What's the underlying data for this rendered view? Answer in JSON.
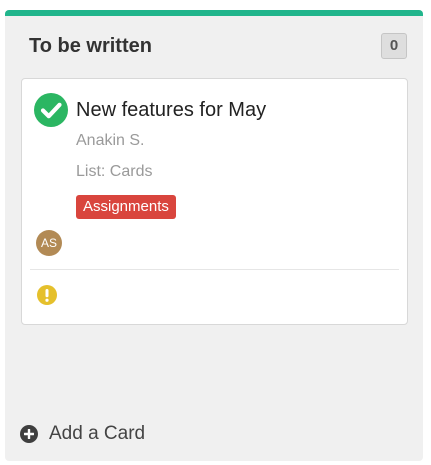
{
  "column": {
    "title": "To be written",
    "count": "0",
    "accent_color": "#21b58c"
  },
  "card": {
    "title": "New features for May",
    "owner": "Anakin S.",
    "list": "List: Cards",
    "tag": {
      "label": "Assignments",
      "color": "#d9453d"
    },
    "avatar_initials": "AS",
    "status_icon": "check-circle-icon",
    "status_color": "#2bb662",
    "alert_icon": "exclamation-circle-icon",
    "alert_color": "#e5c02c"
  },
  "footer": {
    "add_label": "Add a Card",
    "add_icon": "plus-circle-icon"
  }
}
